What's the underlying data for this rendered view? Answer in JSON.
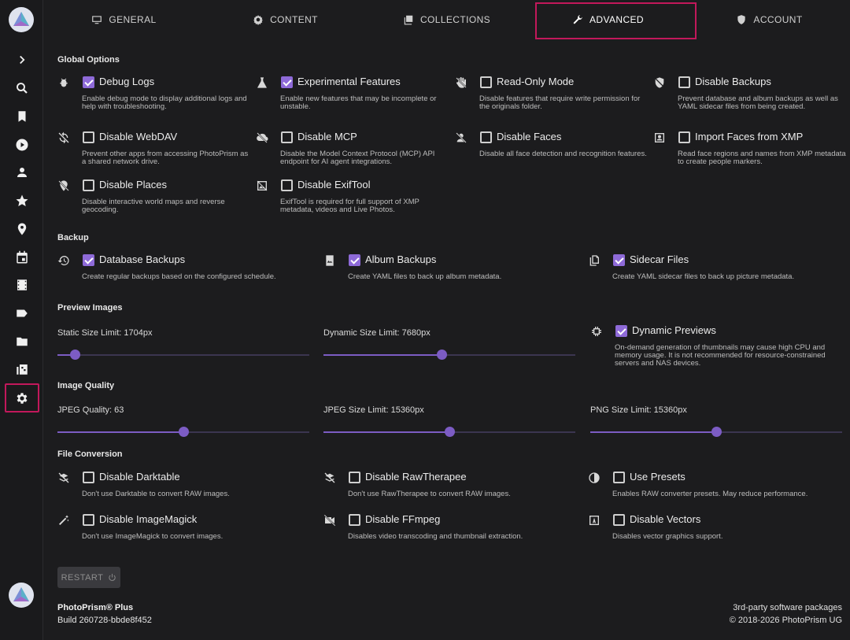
{
  "tabs": [
    {
      "label": "General",
      "icon": "monitor-icon"
    },
    {
      "label": "Content",
      "icon": "gear-outline-icon"
    },
    {
      "label": "Collections",
      "icon": "collections-icon"
    },
    {
      "label": "Advanced",
      "icon": "wrench-icon",
      "active": true
    },
    {
      "label": "Account",
      "icon": "account-shield-icon"
    }
  ],
  "sidebar": {
    "items": [
      "expand-icon",
      "search-icon",
      "bookmark-icon",
      "play-icon",
      "person-icon",
      "star-icon",
      "map-pin-icon",
      "calendar-icon",
      "film-icon",
      "label-icon",
      "folder-icon",
      "library-icon",
      "settings-icon"
    ],
    "active_item": "settings-icon"
  },
  "global": {
    "title": "Global Options",
    "options": [
      {
        "label": "Debug Logs",
        "checked": true,
        "icon": "bug-icon",
        "desc": "Enable debug mode to display additional logs and help with troubleshooting."
      },
      {
        "label": "Experimental Features",
        "checked": true,
        "icon": "flask-icon",
        "desc": "Enable new features that may be incomplete or unstable."
      },
      {
        "label": "Read-Only Mode",
        "checked": false,
        "icon": "hand-off-icon",
        "desc": "Disable features that require write permission for the originals folder."
      },
      {
        "label": "Disable Backups",
        "checked": false,
        "icon": "shield-off-icon",
        "desc": "Prevent database and album backups as well as YAML sidecar files from being created."
      },
      {
        "label": "Disable WebDAV",
        "checked": false,
        "icon": "sync-off-icon",
        "desc": "Prevent other apps from accessing PhotoPrism as a shared network drive."
      },
      {
        "label": "Disable MCP",
        "checked": false,
        "icon": "cloud-off-icon",
        "desc": "Disable the Model Context Protocol (MCP) API endpoint for AI agent integrations."
      },
      {
        "label": "Disable Faces",
        "checked": false,
        "icon": "face-off-icon",
        "desc": "Disable all face detection and recognition features."
      },
      {
        "label": "Import Faces from XMP",
        "checked": false,
        "icon": "portrait-icon",
        "desc": "Read face regions and names from XMP metadata to create people markers."
      },
      {
        "label": "Disable Places",
        "checked": false,
        "icon": "location-off-icon",
        "desc": "Disable interactive world maps and reverse geocoding."
      },
      {
        "label": "Disable ExifTool",
        "checked": false,
        "icon": "image-off-icon",
        "desc": "ExifTool is required for full support of XMP metadata, videos and Live Photos."
      }
    ]
  },
  "backup": {
    "title": "Backup",
    "options": [
      {
        "label": "Database Backups",
        "checked": true,
        "icon": "history-icon",
        "desc": "Create regular backups based on the configured schedule."
      },
      {
        "label": "Album Backups",
        "checked": true,
        "icon": "photo-album-icon",
        "desc": "Create YAML files to back up album metadata."
      },
      {
        "label": "Sidecar Files",
        "checked": true,
        "icon": "file-copy-icon",
        "desc": "Create YAML sidecar files to back up picture metadata."
      }
    ]
  },
  "preview": {
    "title": "Preview Images",
    "static_label": "Static Size Limit: 1704px",
    "static_fraction": 0.07,
    "dynamic_label": "Dynamic Size Limit: 7680px",
    "dynamic_fraction": 0.47,
    "dynamic_previews": {
      "label": "Dynamic Previews",
      "checked": true,
      "icon": "chip-icon",
      "desc": "On-demand generation of thumbnails may cause high CPU and memory usage. It is not recommended for resource-constrained servers and NAS devices."
    }
  },
  "quality": {
    "title": "Image Quality",
    "jpeg_quality_label": "JPEG Quality: 63",
    "jpeg_quality_fraction": 0.5,
    "jpeg_size_label": "JPEG Size Limit: 15360px",
    "jpeg_size_fraction": 0.5,
    "png_size_label": "PNG Size Limit: 15360px",
    "png_size_fraction": 0.5
  },
  "conversion": {
    "title": "File Conversion",
    "options": [
      {
        "label": "Disable Darktable",
        "checked": false,
        "icon": "darktable-off-icon",
        "desc": "Don't use Darktable to convert RAW images."
      },
      {
        "label": "Disable RawTherapee",
        "checked": false,
        "icon": "rawtherapee-off-icon",
        "desc": "Don't use RawTherapee to convert RAW images."
      },
      {
        "label": "Use Presets",
        "checked": false,
        "icon": "contrast-icon",
        "desc": "Enables RAW converter presets. May reduce performance."
      },
      {
        "label": "Disable ImageMagick",
        "checked": false,
        "icon": "magic-wand-icon",
        "desc": "Don't use ImageMagick to convert images."
      },
      {
        "label": "Disable FFmpeg",
        "checked": false,
        "icon": "video-off-icon",
        "desc": "Disables video transcoding and thumbnail extraction."
      },
      {
        "label": "Disable Vectors",
        "checked": false,
        "icon": "vector-icon",
        "desc": "Disables vector graphics support."
      }
    ]
  },
  "restart_label": "Restart",
  "footer": {
    "product": "PhotoPrism® Plus",
    "build": "Build 260728-bbde8f452",
    "packages": "3rd-party software packages",
    "copyright": "© 2018-2026 PhotoPrism UG"
  },
  "colors": {
    "accent": "#7c5cc4",
    "checkbox": "#8e6ad8",
    "highlight": "#c2185b",
    "background": "#1c1c1e"
  }
}
